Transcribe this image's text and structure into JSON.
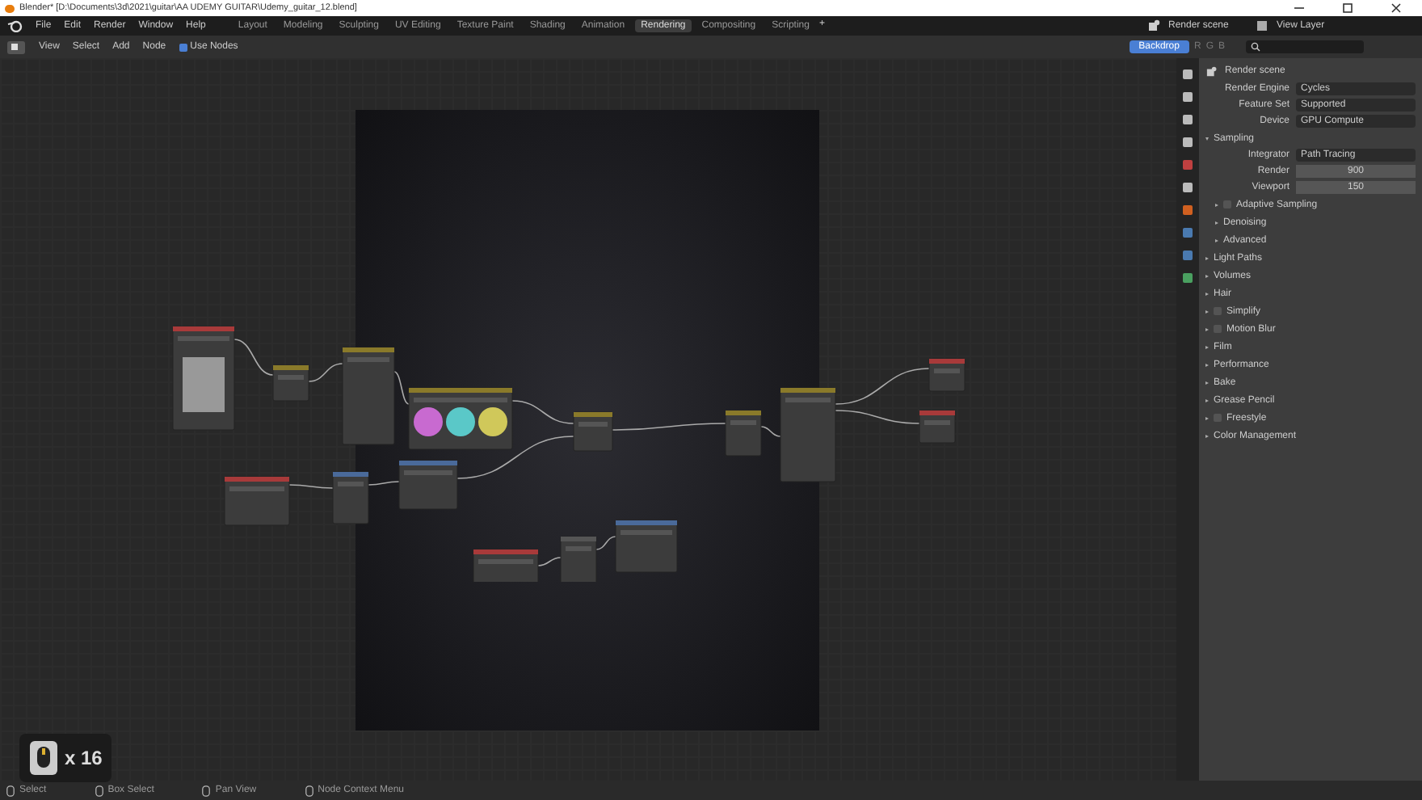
{
  "window": {
    "title": "Blender* [D:\\Documents\\3d\\2021\\guitar\\AA UDEMY GUITAR\\Udemy_guitar_12.blend]"
  },
  "menu": [
    "File",
    "Edit",
    "Render",
    "Window",
    "Help"
  ],
  "workspaces": [
    {
      "label": "Layout",
      "selected": false
    },
    {
      "label": "Modeling",
      "selected": false
    },
    {
      "label": "Sculpting",
      "selected": false
    },
    {
      "label": "UV Editing",
      "selected": false
    },
    {
      "label": "Texture Paint",
      "selected": false
    },
    {
      "label": "Shading",
      "selected": false
    },
    {
      "label": "Animation",
      "selected": false
    },
    {
      "label": "Rendering",
      "selected": true
    },
    {
      "label": "Compositing",
      "selected": false
    },
    {
      "label": "Scripting",
      "selected": false
    }
  ],
  "add_workspace": "+",
  "scene": "Render scene",
  "view_layer": "View Layer",
  "node_header": {
    "menus": [
      "View",
      "Select",
      "Add",
      "Node"
    ],
    "use_nodes": {
      "label": "Use Nodes",
      "checked": true
    },
    "backdrop": {
      "label": "Backdrop",
      "on": true
    },
    "channels": [
      "R",
      "G",
      "B"
    ]
  },
  "properties": {
    "title": "Render scene",
    "fields": [
      {
        "label": "Render Engine",
        "value": "Cycles"
      },
      {
        "label": "Feature Set",
        "value": "Supported"
      },
      {
        "label": "Device",
        "value": "GPU Compute"
      }
    ],
    "sections": [
      {
        "label": "Sampling",
        "kind": "plain",
        "expanded": true,
        "fields": [
          {
            "label": "Integrator",
            "value": "Path Tracing",
            "kind": "dropdown"
          },
          {
            "label": "Render",
            "value": "900",
            "kind": "number"
          },
          {
            "label": "Viewport",
            "value": "150",
            "kind": "number"
          }
        ],
        "subsections": [
          {
            "label": "Adaptive Sampling",
            "kind": "checkbox",
            "checked": false
          },
          {
            "label": "Denoising",
            "kind": "plain"
          },
          {
            "label": "Advanced",
            "kind": "plain"
          }
        ]
      },
      {
        "label": "Light Paths",
        "kind": "plain",
        "expanded": false
      },
      {
        "label": "Volumes",
        "kind": "plain",
        "expanded": false
      },
      {
        "label": "Hair",
        "kind": "plain",
        "expanded": false
      },
      {
        "label": "Simplify",
        "kind": "checkbox",
        "checked": false,
        "expanded": false
      },
      {
        "label": "Motion Blur",
        "kind": "checkbox",
        "checked": false,
        "expanded": false
      },
      {
        "label": "Film",
        "kind": "plain",
        "expanded": false
      },
      {
        "label": "Performance",
        "kind": "plain",
        "expanded": false
      },
      {
        "label": "Bake",
        "kind": "plain",
        "expanded": false
      },
      {
        "label": "Grease Pencil",
        "kind": "plain",
        "expanded": false
      },
      {
        "label": "Freestyle",
        "kind": "checkbox",
        "checked": false,
        "expanded": false
      },
      {
        "label": "Color Management",
        "kind": "plain",
        "expanded": false
      }
    ]
  },
  "click_overlay": {
    "count": "x 16"
  },
  "status_bar": [
    "Select",
    "Box Select",
    "Pan View",
    "Node Context Menu"
  ]
}
